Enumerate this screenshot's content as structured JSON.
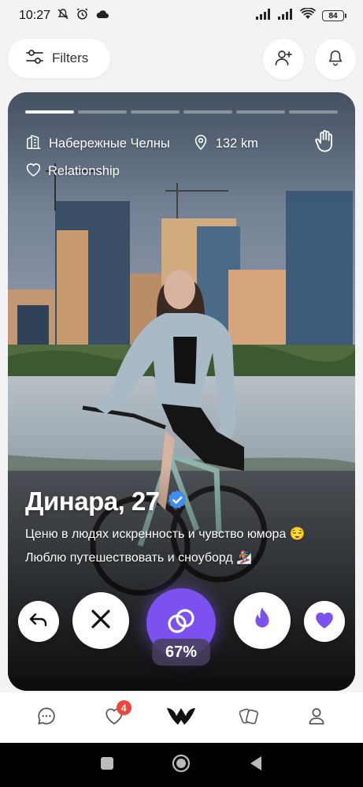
{
  "status_bar": {
    "time": "10:27",
    "battery": "84",
    "icons": [
      "mute-icon",
      "alarm-icon",
      "cloud-icon",
      "signal-icon",
      "signal-icon",
      "wifi-icon",
      "battery-icon"
    ]
  },
  "top_bar": {
    "filters_label": "Filters",
    "icons": [
      "filters-icon",
      "add-user-icon",
      "bell-icon"
    ]
  },
  "profile": {
    "photo_count": 6,
    "active_photo": 1,
    "city": "Набережные Челны",
    "distance": "132 km",
    "looking_for": "Relationship",
    "name_age": "Динара, 27",
    "bio": [
      "Ценю в людях искренность и чувство юмора 😌",
      "Люблю путешествовать и сноуборд 🏂"
    ],
    "match_percent": "67%"
  },
  "actions": [
    "undo-icon",
    "close-icon",
    "match-rings-icon",
    "flame-icon",
    "heart-icon"
  ],
  "bottom_nav": {
    "items": [
      "chat-icon",
      "likes-icon",
      "home-logo-icon",
      "cards-icon",
      "profile-icon"
    ],
    "likes_badge": "4"
  },
  "colors": {
    "accent": "#7b52ef",
    "accent_light": "#8f6cf4",
    "badge": "#f0453a",
    "verified": "#3f8cf2"
  }
}
